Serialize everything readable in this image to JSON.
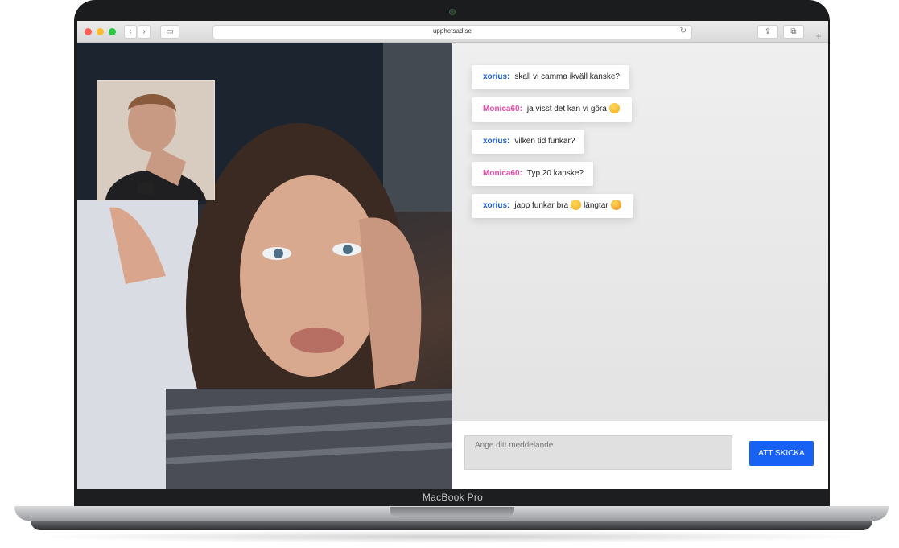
{
  "device": {
    "label": "MacBook Pro"
  },
  "browser": {
    "url": "upphetsad.se",
    "traffic_lights": [
      "#ff5f57",
      "#febc2e",
      "#28c840"
    ],
    "icons": [
      "back-icon",
      "forward-icon",
      "sidebar-icon",
      "reload-icon",
      "share-icon",
      "tabs-icon",
      "new-tab-icon"
    ]
  },
  "chat": {
    "colors": {
      "user_a": "#1a5ad7",
      "user_b": "#e44aa8",
      "send": "#1762f5"
    },
    "messages": [
      {
        "user": "xorius:",
        "text": "skall vi camma ikväll kanske?",
        "emoji": []
      },
      {
        "user": "Monica60:",
        "text": "ja visst det kan vi göra",
        "emoji": [
          "smile-emoji"
        ]
      },
      {
        "user": "xorius:",
        "text": "vilken tid funkar?",
        "emoji": []
      },
      {
        "user": "Monica60:",
        "text": "Typ 20 kanske?",
        "emoji": []
      },
      {
        "user": "xorius:",
        "text": "japp funkar bra",
        "text2": "längtar",
        "emoji": [
          "wink-emoji",
          "kiss-emoji"
        ]
      }
    ]
  },
  "composer": {
    "placeholder": "Ange ditt meddelande",
    "send_label": "ATT SKICKA"
  }
}
